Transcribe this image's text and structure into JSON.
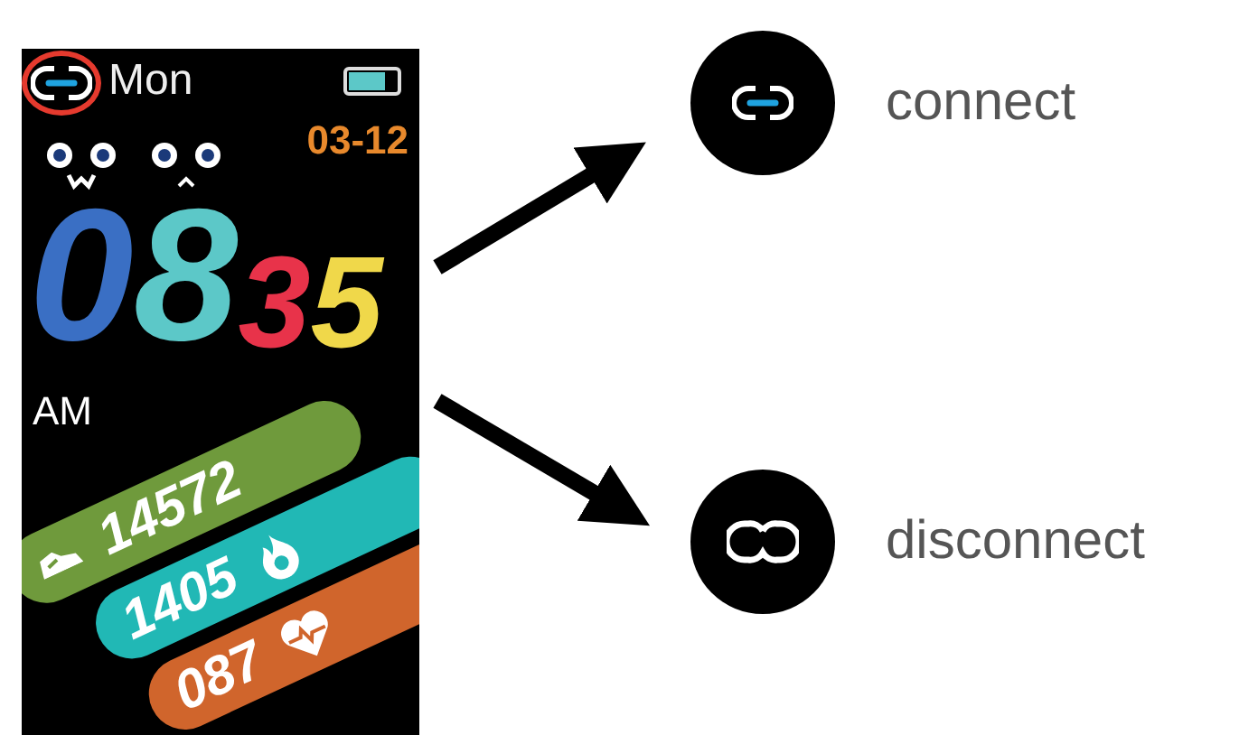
{
  "watch": {
    "connected": true,
    "day": "Mon",
    "battery": {
      "level": 0.75
    },
    "date": "03-12",
    "time_digits": [
      {
        "digit": "0",
        "color": "#3a6fc4",
        "kind": "face"
      },
      {
        "digit": "8",
        "color": "#5cc8c8",
        "kind": "face"
      },
      {
        "digit": "3",
        "color": "#e8334a",
        "kind": "plain"
      },
      {
        "digit": "5",
        "color": "#f0d84a",
        "kind": "plain"
      }
    ],
    "meridiem": "AM",
    "stats": [
      {
        "kind": "steps",
        "value": "14572",
        "color": "#6f9a3c"
      },
      {
        "kind": "calories",
        "value": "1405",
        "color": "#21b8b5"
      },
      {
        "kind": "heart",
        "value": "087",
        "color": "#d0652c"
      }
    ]
  },
  "legend": [
    {
      "kind": "connect",
      "label": "connect"
    },
    {
      "kind": "disconnect",
      "label": "disconnect"
    }
  ]
}
